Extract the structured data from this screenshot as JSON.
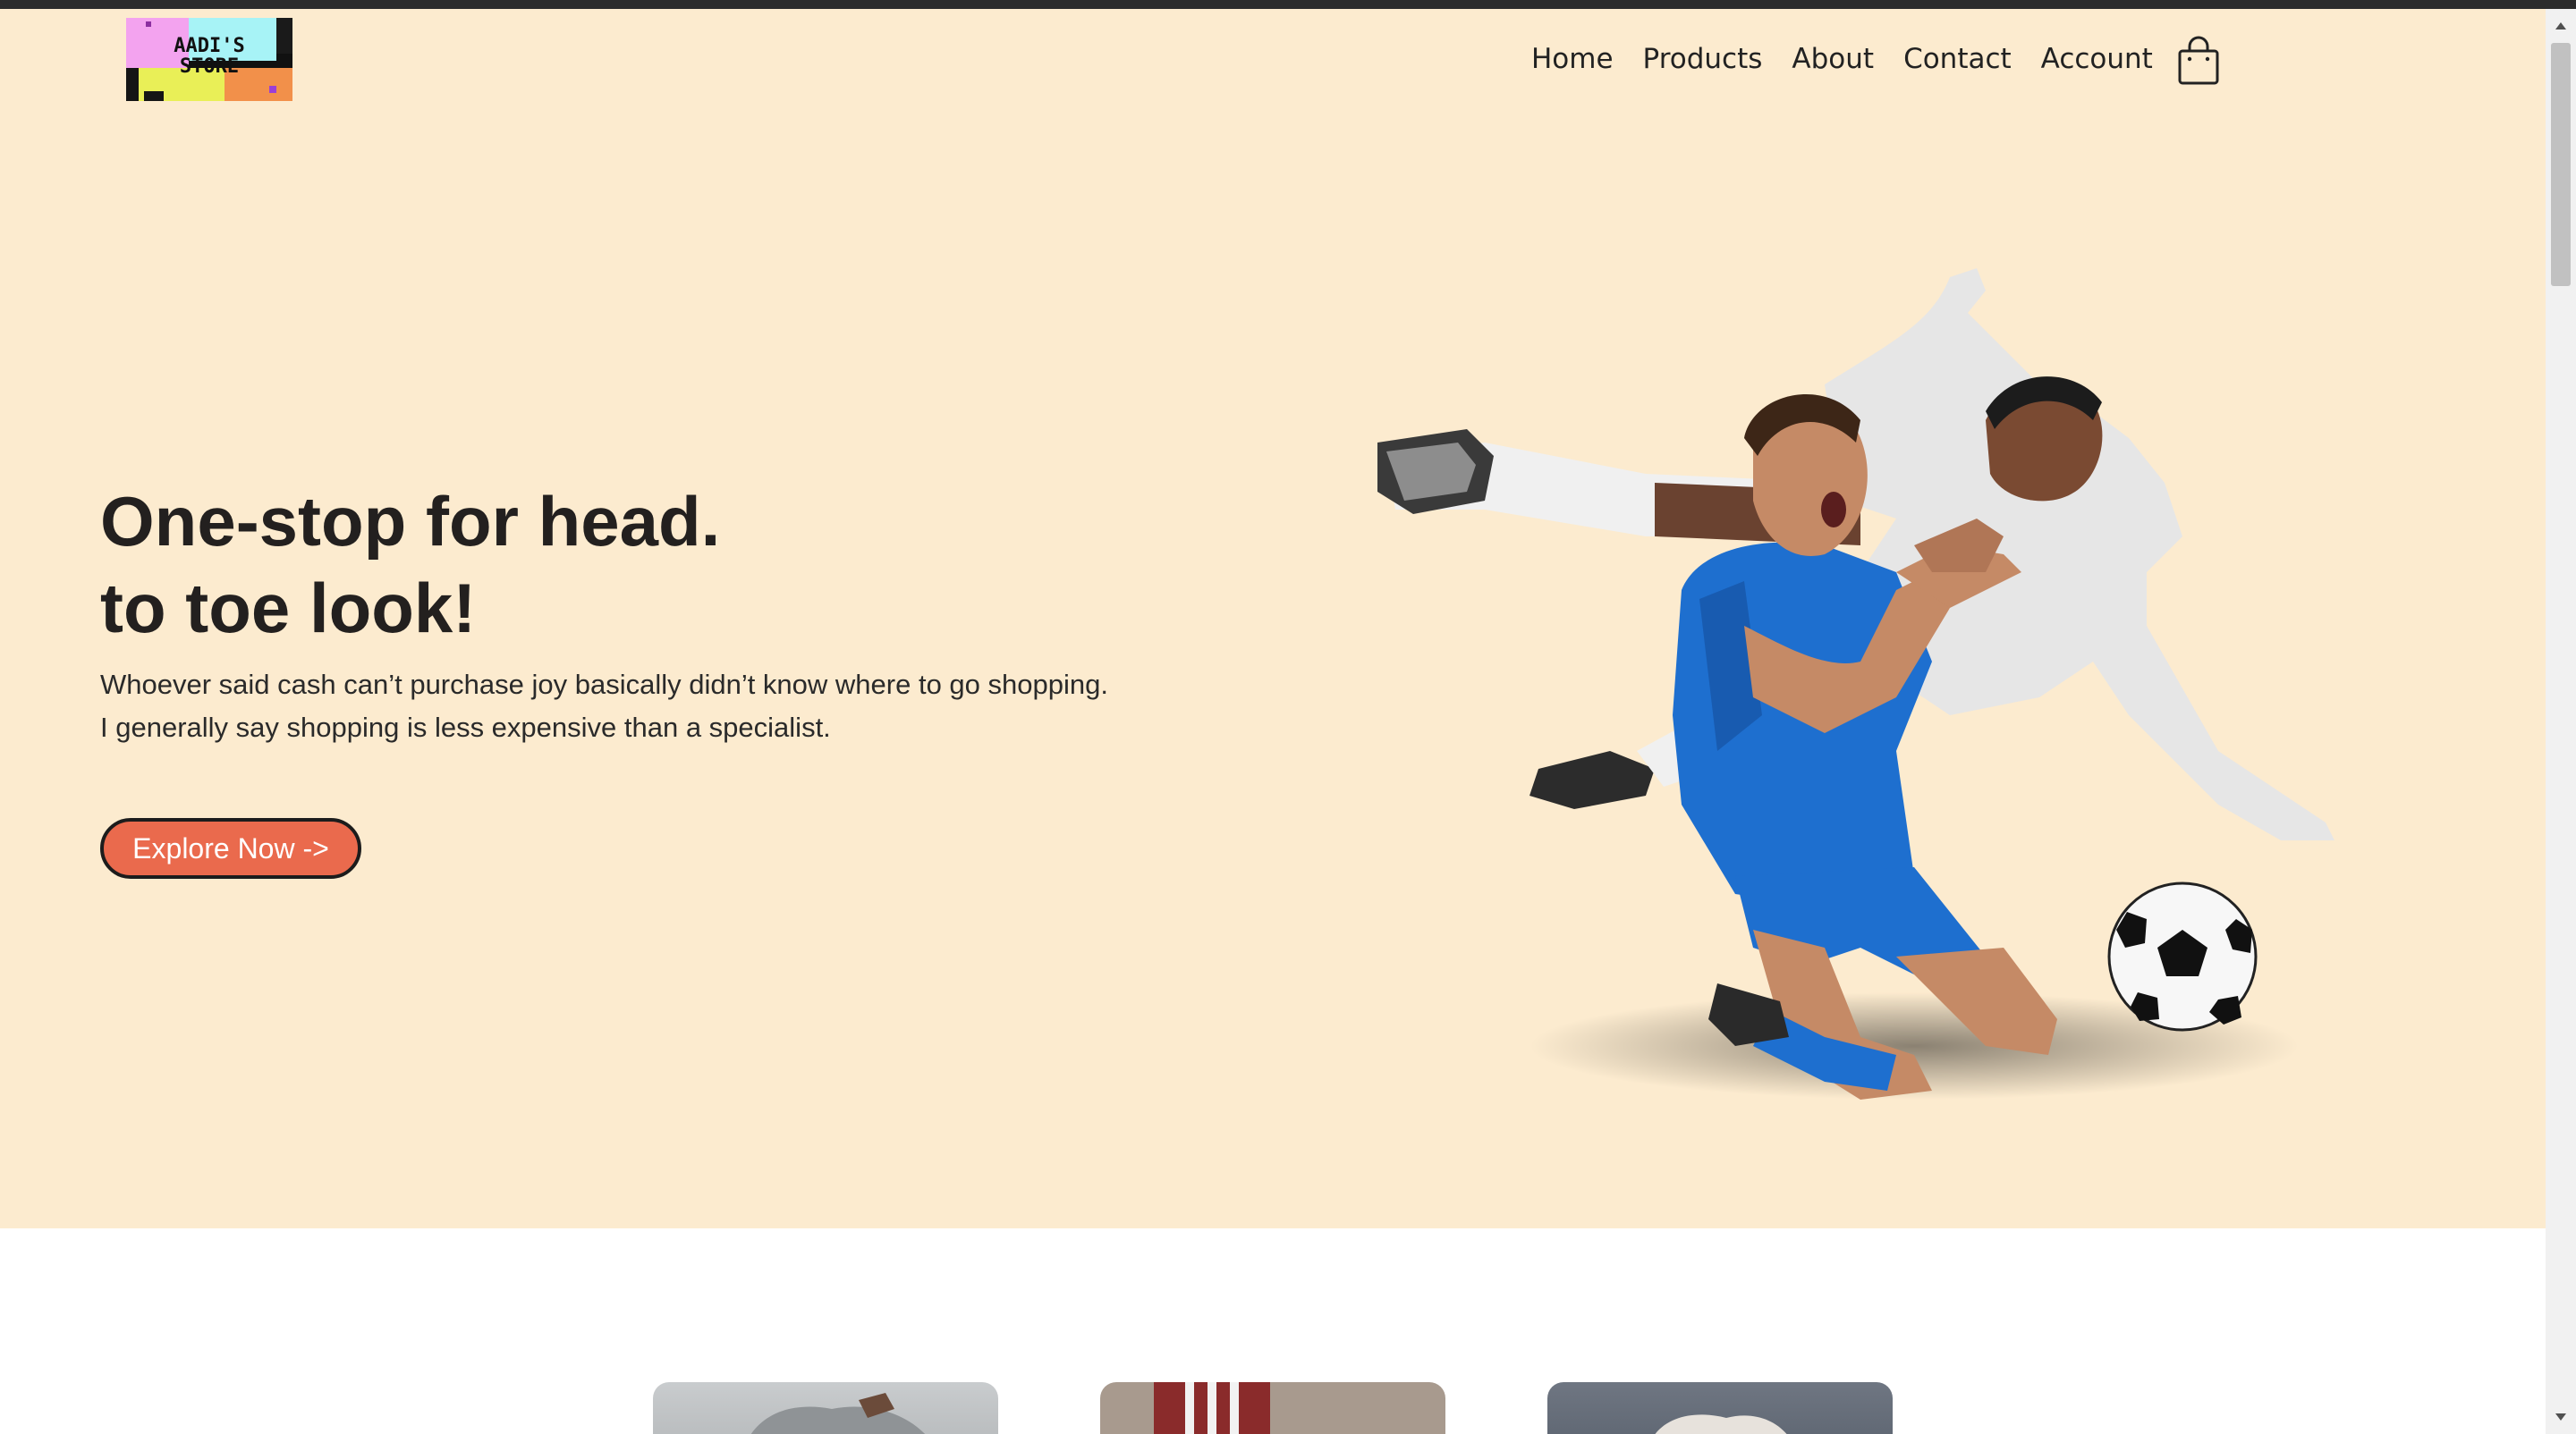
{
  "logo": {
    "text": "AADI'S\nSTORE"
  },
  "nav": {
    "items": [
      {
        "label": "Home"
      },
      {
        "label": "Products"
      },
      {
        "label": "About"
      },
      {
        "label": "Contact"
      },
      {
        "label": "Account"
      }
    ],
    "cart_icon": "shopping-bag-icon"
  },
  "hero": {
    "headline_line1": "One-stop for head.",
    "headline_line2": "to toe look!",
    "subcopy_line1": "Whoever said cash can’t purchase joy basically didn’t know where to go shopping.",
    "subcopy_line2": "I generally say shopping is less expensive than a specialist.",
    "cta_label": "Explore Now ->",
    "image": "football-players-photo"
  },
  "colors": {
    "hero_background": "#fcebcf",
    "cta_background": "#ea6a4d",
    "text": "#23201f"
  },
  "cards": [
    "fashion-photo-1",
    "fashion-photo-2",
    "fashion-photo-3"
  ]
}
